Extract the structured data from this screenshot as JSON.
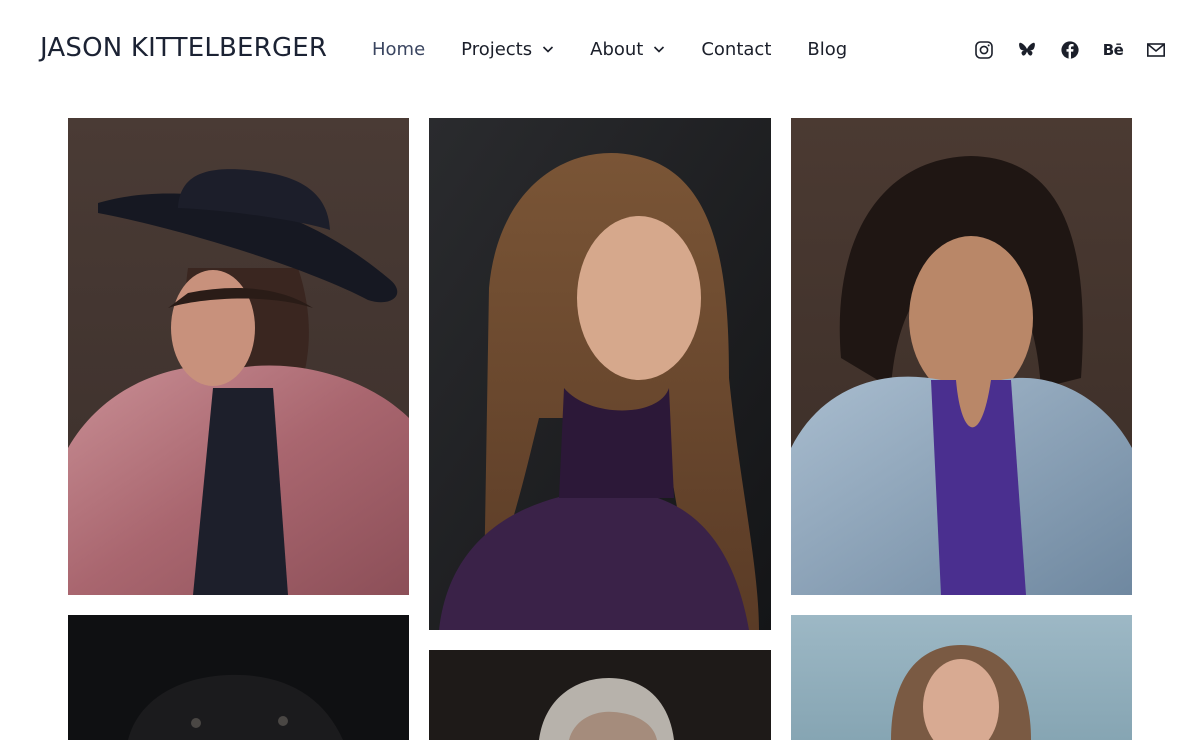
{
  "site": {
    "title": "JASON KITTELBERGER"
  },
  "nav": {
    "items": [
      {
        "label": "Home",
        "active": true,
        "dropdown": false
      },
      {
        "label": "Projects",
        "active": false,
        "dropdown": true
      },
      {
        "label": "About",
        "active": false,
        "dropdown": true
      },
      {
        "label": "Contact",
        "active": false,
        "dropdown": false
      },
      {
        "label": "Blog",
        "active": false,
        "dropdown": false
      }
    ]
  },
  "social": {
    "icons": [
      "instagram-icon",
      "bluesky-icon",
      "facebook-icon",
      "behance-icon",
      "email-icon"
    ],
    "behance_label": "Bē"
  },
  "colors": {
    "text": "#1b1f2a",
    "background": "#ffffff"
  }
}
